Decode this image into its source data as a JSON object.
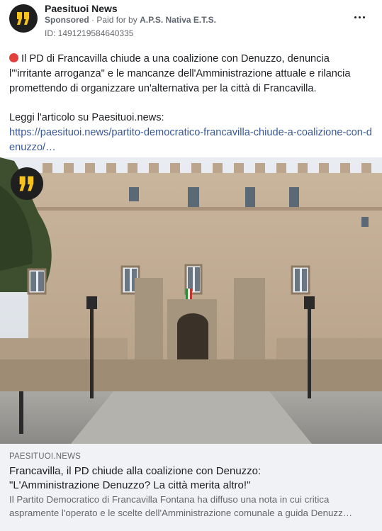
{
  "post": {
    "page_name": "Paesituoi News",
    "sponsored_label": "Sponsored",
    "paid_prefix": "Paid for by",
    "payer": "A.P.S. Nativa E.T.S.",
    "ad_id": "ID: 1491219584640335",
    "more_icon": "more-horizontal-icon",
    "text_main": "Il PD di Francavilla chiude a una coalizione con Denuzzo, denuncia l'\"irritante arroganza\" e le mancanze dell'Amministrazione attuale e rilancia promettendo di organizzare un'alternativa per la città di Francavilla.",
    "read_label": "Leggi l'articolo su Paesituoi.news:",
    "article_url": "https://paesituoi.news/partito-democratico-francavilla-chiude-a-coalizione-con-denuzzo/…"
  },
  "link_card": {
    "domain": "PAESITUOI.NEWS",
    "headline_line1": "Francavilla, il PD chiude alla coalizione con Denuzzo:",
    "headline_line2": "\"L'Amministrazione Denuzzo? La città merita altro!\"",
    "description_line1": "Il Partito Democratico di Francavilla Fontana ha diffuso una nota in cui critica",
    "description_line2": "aspramente l'operato e le scelte dell'Amministrazione comunale a guida Denuzz…"
  },
  "colors": {
    "link": "#385898",
    "logo_yellow": "#f7c21b",
    "red_dot": "#e2403b"
  }
}
